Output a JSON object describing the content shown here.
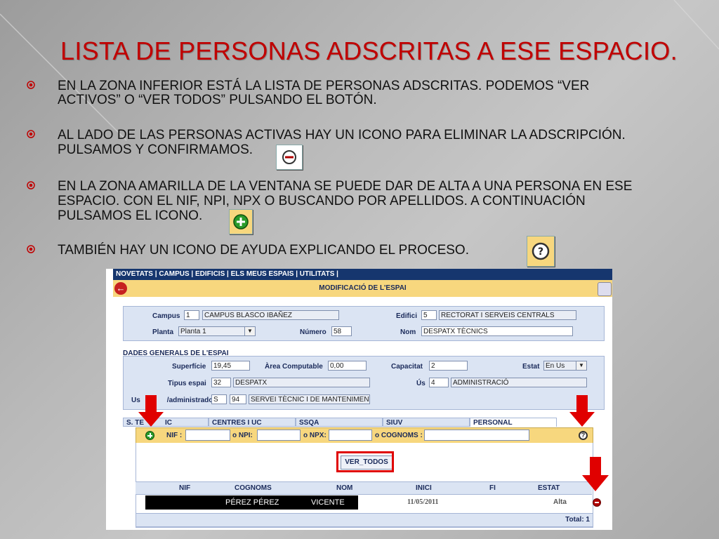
{
  "slide": {
    "title": "LISTA DE PERSONAS ADSCRITAS A ESE ESPACIO.",
    "bullets": [
      {
        "line1": "EN LA ZONA INFERIOR ESTÁ LA LISTA DE PERSONAS ADSCRITAS. PODEMOS “VER",
        "line2": "ACTIVOS” O “VER TODOS” PULSANDO EL BOTÓN."
      },
      {
        "line1": "AL LADO DE LAS PERSONAS ACTIVAS HAY UN ICONO PARA ELIMINAR LA ADSCRIPCIÓN.",
        "line2": "PULSAMOS Y CONFIRMAMOS."
      },
      {
        "line1": "EN LA ZONA AMARILLA DE LA VENTANA SE PUEDE DAR DE ALTA A UNA PERSONA EN ESE",
        "line2": "ESPACIO. CON EL NIF, NPI, NPX O BUSCANDO POR APELLIDOS. A CONTINUACIÓN",
        "line3": "PULSAMOS EL ICONO."
      },
      {
        "line1": "TAMBIÉN  HAY UN ICONO DE AYUDA  EXPLICANDO EL PROCESO."
      }
    ],
    "colors": {
      "title": "#c00000",
      "highlight": "#e00000",
      "nav": "#16366e",
      "header": "#f7d77e"
    }
  },
  "app": {
    "nav": "NOVETATS | CAMPUS | EDIFICIS | ELS MEUS ESPAIS | UTILITATS |",
    "header_title": "MODIFICACIÓ DE L'ESPAI",
    "location": {
      "campus_label": "Campus",
      "campus_code": "1",
      "campus_name": "CAMPUS BLASCO IBAÑEZ",
      "edifici_label": "Edifici",
      "edifici_code": "5",
      "edifici_name": "RECTORAT I SERVEIS CENTRALS",
      "planta_label": "Planta",
      "planta_value": "Planta 1",
      "numero_label": "Número",
      "numero_value": "58",
      "nom_label": "Nom",
      "nom_value": "DESPATX TÈCNICS"
    },
    "section_title": "DADES GENERALS DE L'ESPAI",
    "general": {
      "superficie_label": "Superfície",
      "superficie_value": "19,45",
      "area_label": "Àrea Computable",
      "area_value": "0,00",
      "capacitat_label": "Capacitat",
      "capacitat_value": "2",
      "estat_label": "Estat",
      "estat_value": "En Us",
      "tipus_label": "Tipus espai",
      "tipus_code": "32",
      "tipus_name": "DESPATX",
      "us_label": "Ús",
      "us_code": "4",
      "us_name": "ADMINISTRACIÓ",
      "admin_label_a": "Us",
      "admin_label_b": "/administrador",
      "admin_code1": "S",
      "admin_code2": "94",
      "admin_name": "SERVEI TÈCNIC I DE MANTENIMENT"
    },
    "tabs": [
      {
        "label": "S. TE",
        "label2": "IC"
      },
      {
        "label": "CENTRES I UC"
      },
      {
        "label": "SSQA"
      },
      {
        "label": "SIUV"
      },
      {
        "label": "PERSONAL"
      }
    ],
    "search": {
      "nif_label": "NIF :",
      "npi_label": "o NPI:",
      "npx_label": "o NPX:",
      "cognoms_label": "o COGNOMS :"
    },
    "ver_todos_label": "VER_TODOS",
    "table": {
      "headers": [
        "NIF",
        "COGNOMS",
        "NOM",
        "INICI",
        "FI",
        "ESTAT"
      ],
      "rows": [
        {
          "cognoms": "PÉREZ PÉREZ",
          "nom": "VICENTE",
          "inici": "11/05/2011",
          "estat": "Alta"
        }
      ],
      "total": "Total: 1"
    }
  }
}
